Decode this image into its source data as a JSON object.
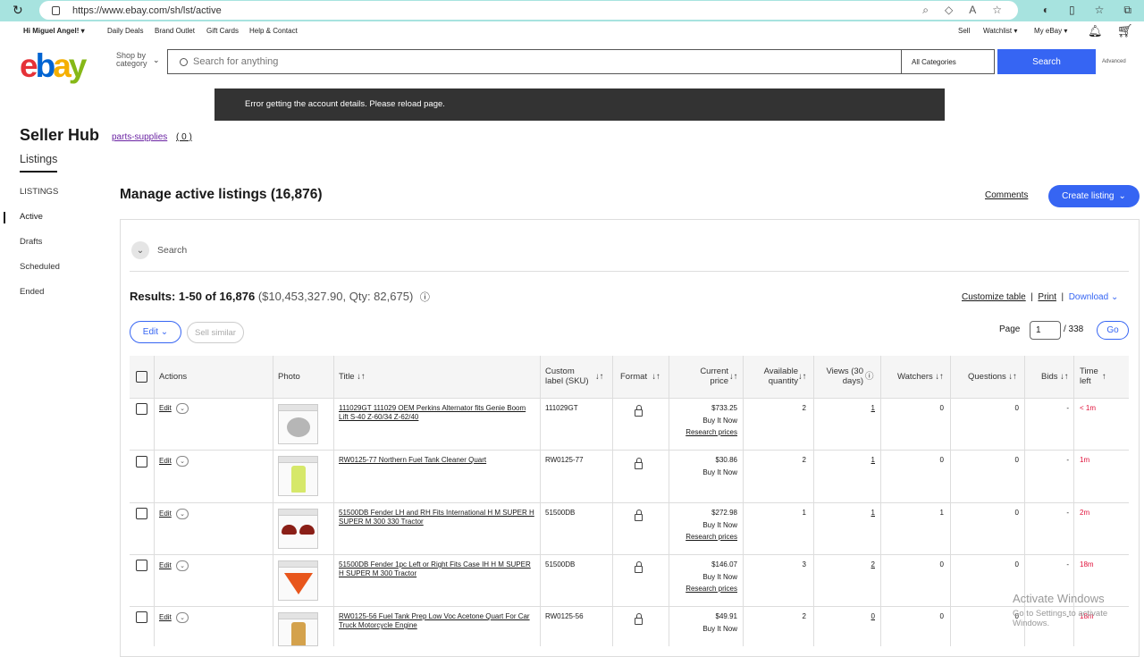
{
  "browser": {
    "url": "https://www.ebay.com/sh/lst/active"
  },
  "topnav": {
    "greeting": "Hi Miguel Angel!",
    "daily_deals": "Daily Deals",
    "brand_outlet": "Brand Outlet",
    "gift_cards": "Gift Cards",
    "help": "Help & Contact",
    "sell": "Sell",
    "watchlist": "Watchlist",
    "my_ebay": "My eBay"
  },
  "header": {
    "logo_letters": [
      "e",
      "b",
      "a",
      "y"
    ],
    "shop_by_line1": "Shop by",
    "shop_by_line2": "category",
    "search_placeholder": "Search for anything",
    "category": "All Categories",
    "search_button": "Search",
    "advanced": "Advanced"
  },
  "banner": {
    "error": "Error getting the account details. Please reload page."
  },
  "hub": {
    "title": "Seller Hub",
    "store_link": "parts-supplies",
    "store_count": "( 0 )",
    "tab": "Listings"
  },
  "sidebar": {
    "heading": "LISTINGS",
    "items": [
      "Active",
      "Drafts",
      "Scheduled",
      "Ended"
    ]
  },
  "main": {
    "heading": "Manage active listings (16,876)",
    "comments": "Comments",
    "create_listing": "Create listing",
    "search_label": "Search",
    "results_main": "Results: 1-50 of 16,876",
    "results_sub": "($10,453,327.90, Qty: 82,675)",
    "customize": "Customize table",
    "print": "Print",
    "download": "Download",
    "edit": "Edit",
    "sell_similar": "Sell similar",
    "page_label": "Page",
    "page_value": "1",
    "page_total": "/ 338",
    "go": "Go"
  },
  "table": {
    "headers": {
      "actions": "Actions",
      "photo": "Photo",
      "title": "Title",
      "sku_1": "Custom",
      "sku_2": "label (SKU)",
      "format": "Format",
      "price_1": "Current",
      "price_2": "price",
      "qty_1": "Available",
      "qty_2": "quantity",
      "views_1": "Views (30",
      "views_2": "days)",
      "watchers": "Watchers",
      "questions": "Questions",
      "bids": "Bids",
      "time_1": "Time",
      "time_2": "left"
    },
    "rows": [
      {
        "edit": "Edit",
        "title": "111029GT 111029 OEM Perkins Alternator fits Genie Boom Lift S-40 Z-60/34 Z-62/40",
        "sku": "111029GT",
        "price": "$733.25",
        "buy": "Buy It Now",
        "research": "Research prices",
        "qty": "2",
        "views": "1",
        "watchers": "0",
        "questions": "0",
        "bids": "-",
        "time_left": "< 1m"
      },
      {
        "edit": "Edit",
        "title": "RW0125-77 Northern Fuel Tank Cleaner Quart",
        "sku": "RW0125-77",
        "price": "$30.86",
        "buy": "Buy It Now",
        "research": "",
        "qty": "2",
        "views": "1",
        "watchers": "0",
        "questions": "0",
        "bids": "-",
        "time_left": "1m"
      },
      {
        "edit": "Edit",
        "title": "51500DB Fender LH and RH Fits International H M SUPER H SUPER M 300 330 Tractor",
        "sku": "51500DB",
        "price": "$272.98",
        "buy": "Buy It Now",
        "research": "Research prices",
        "qty": "1",
        "views": "1",
        "watchers": "1",
        "questions": "0",
        "bids": "-",
        "time_left": "2m"
      },
      {
        "edit": "Edit",
        "title": "51500DB Fender 1pc Left or Right Fits Case IH H M SUPER H SUPER M 300 Tractor",
        "sku": "51500DB",
        "price": "$146.07",
        "buy": "Buy It Now",
        "research": "Research prices",
        "qty": "3",
        "views": "2",
        "watchers": "0",
        "questions": "0",
        "bids": "-",
        "time_left": "18m"
      },
      {
        "edit": "Edit",
        "title": "RW0125-56 Fuel Tank Prep Low Voc Acetone Quart For Car Truck Motorcycle Engine",
        "sku": "RW0125-56",
        "price": "$49.91",
        "buy": "Buy It Now",
        "research": "",
        "qty": "2",
        "views": "0",
        "watchers": "0",
        "questions": "0",
        "bids": "-",
        "time_left": "18m"
      }
    ]
  },
  "watermark": {
    "line1": "Activate Windows",
    "line2": "Go to Settings to activate Windows."
  }
}
